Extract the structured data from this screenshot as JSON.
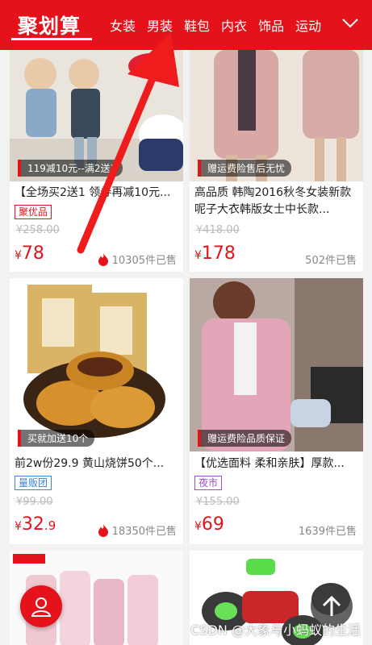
{
  "header": {
    "logo": "聚划算",
    "tabs": [
      "女装",
      "男装",
      "鞋包",
      "内衣",
      "饰品",
      "运动"
    ],
    "expand_icon": "chevron-down-icon"
  },
  "products": [
    {
      "promo": "119减10元--满2送1",
      "title": "【全场买2送1 领券再减10元...",
      "badge": "聚优品",
      "old_price": "¥258.00",
      "currency": "¥",
      "price": "78",
      "price_dec": "",
      "sold": "10305件已售",
      "hot": true
    },
    {
      "promo": "赠运费险售后无忧",
      "title": "高品质 韩陶2016秋冬女装新款呢子大衣韩版女士中长款...",
      "badge": "",
      "old_price": "¥418.00",
      "currency": "¥",
      "price": "178",
      "price_dec": "",
      "sold": "502件已售",
      "hot": false
    },
    {
      "promo": "买就加送10个",
      "title": "前2w份29.9 黄山烧饼50个...",
      "badge": "量贩团",
      "old_price": "¥99.00",
      "currency": "¥",
      "price": "32",
      "price_dec": ".9",
      "sold": "18350件已售",
      "hot": true
    },
    {
      "promo": "赠运费险品质保证",
      "title": "【优选面料 柔和亲肤】厚款...",
      "badge": "夜市",
      "old_price": "¥155.00",
      "currency": "¥",
      "price": "69",
      "price_dec": "",
      "sold": "1639件已售",
      "hot": false
    }
  ],
  "colors": {
    "brand": "#e4121a",
    "badge_red": "#e4121a",
    "badge_blue": "#3b82d6",
    "badge_purple": "#9b4fc9"
  },
  "watermark": "CSDN @大象与小蚂蚁的生活",
  "fab": {
    "user_icon": "user-icon",
    "top_icon": "arrow-up-icon"
  }
}
